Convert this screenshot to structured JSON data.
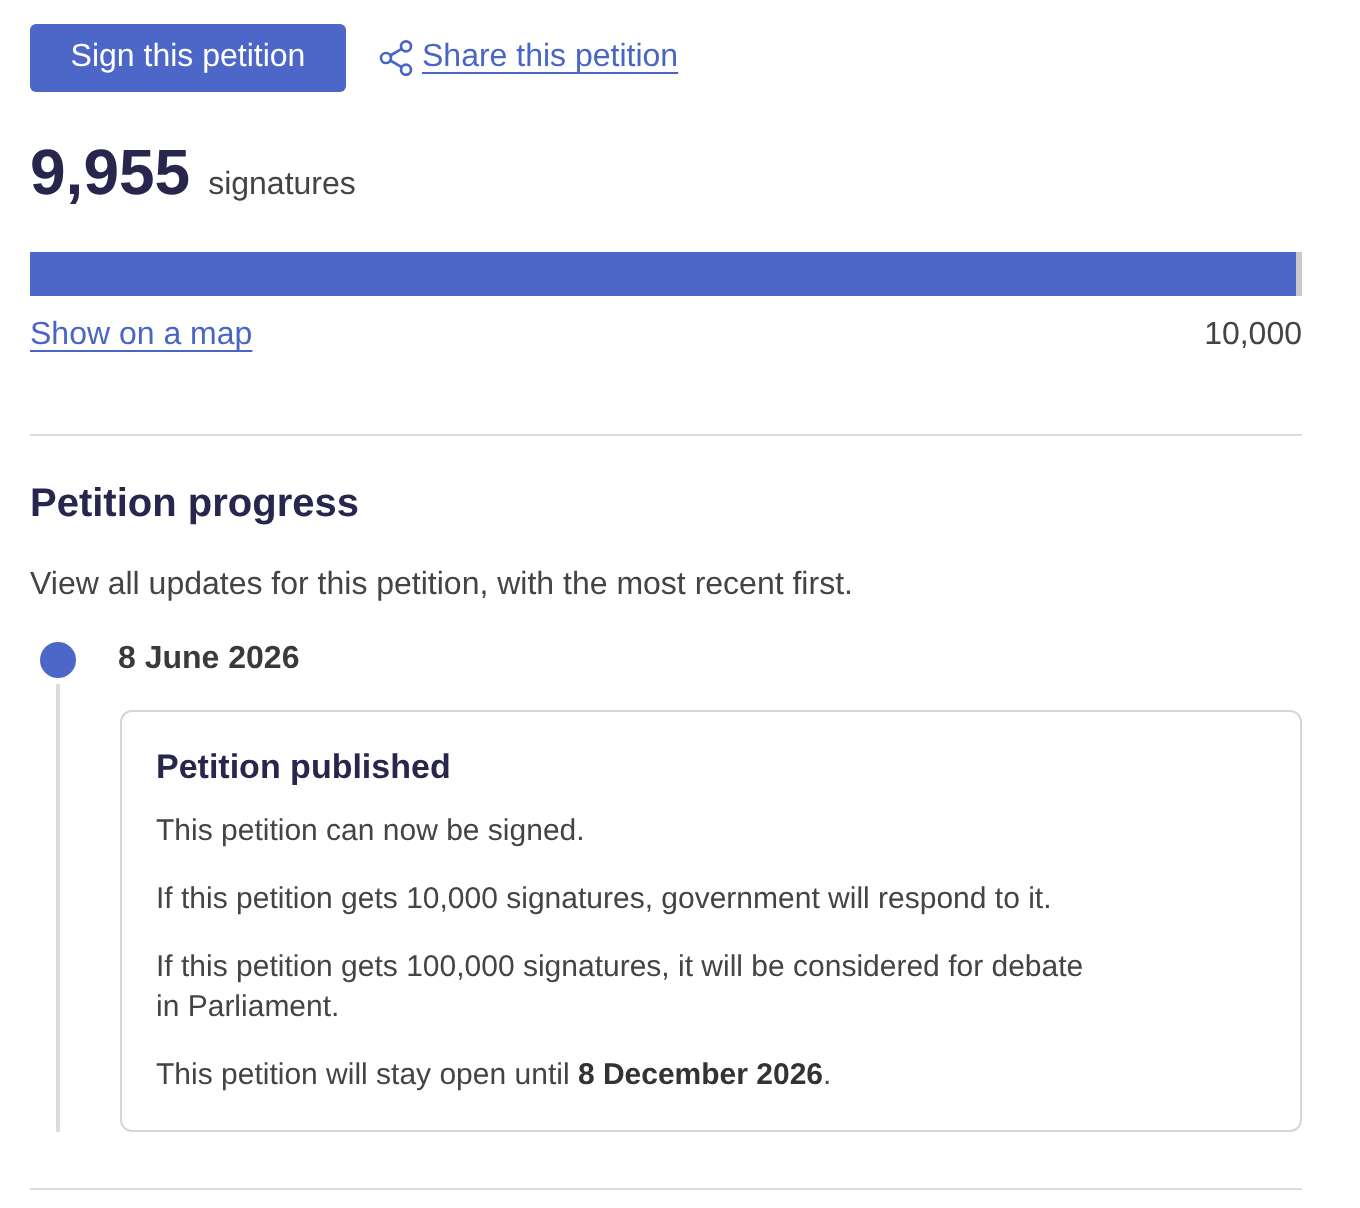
{
  "actions": {
    "sign_button": "Sign this petition",
    "share_link": "Share this petition"
  },
  "signatures": {
    "count": "9,955",
    "label": "signatures",
    "level": 0.9955,
    "map_link": "Show on a map",
    "target": "10,000"
  },
  "progress": {
    "heading": "Petition progress",
    "intro": "View all updates for this petition, with the most recent first.",
    "updates": [
      {
        "date": "8 June 2026",
        "title": "Petition published",
        "paragraphs": [
          "This petition can now be signed.",
          "If this petition gets 10,000 signatures, government will respond to it.",
          "If this petition gets 100,000 signatures, it will be considered for debate in Parliament.",
          "This petition will stay open until **8 December 2026**."
        ]
      }
    ]
  }
}
